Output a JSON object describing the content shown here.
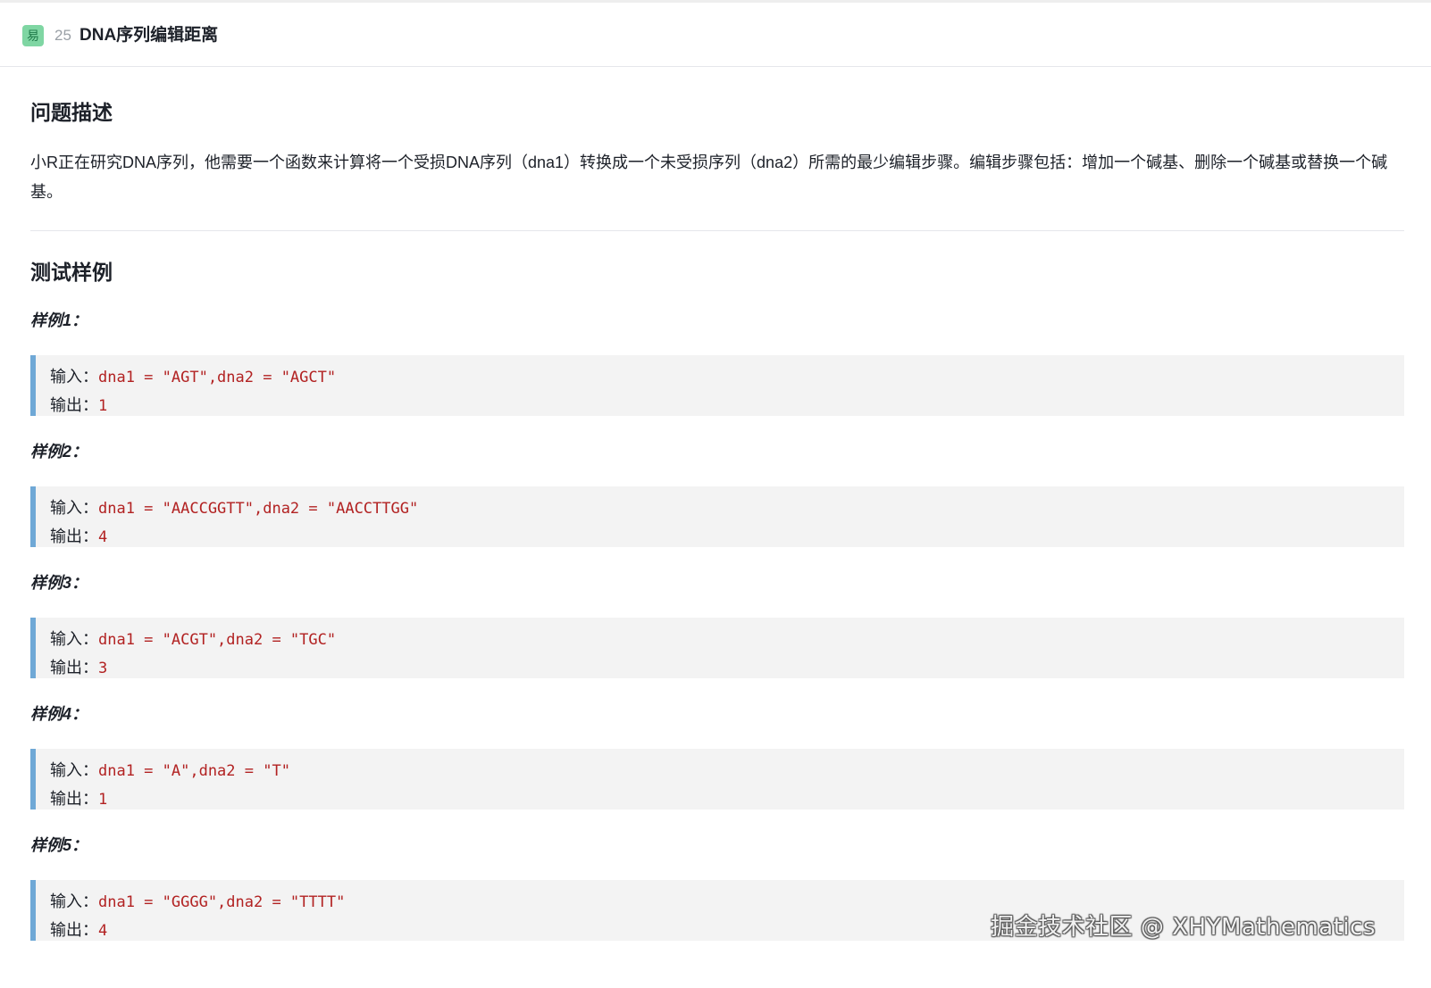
{
  "header": {
    "difficulty": "易",
    "number": "25",
    "title": "DNA序列编辑距离"
  },
  "sections": {
    "problem_heading": "问题描述",
    "problem_text": "小R正在研究DNA序列，他需要一个函数来计算将一个受损DNA序列（dna1）转换成一个未受损序列（dna2）所需的最少编辑步骤。编辑步骤包括：增加一个碱基、删除一个碱基或替换一个碱基。",
    "examples_heading": "测试样例"
  },
  "examples": [
    {
      "label": "样例1：",
      "input_prefix": "输入：",
      "input": "dna1 = \"AGT\",dna2 = \"AGCT\"",
      "output_prefix": "输出：",
      "output": "1"
    },
    {
      "label": "样例2：",
      "input_prefix": "输入：",
      "input": "dna1 = \"AACCGGTT\",dna2 = \"AACCTTGG\"",
      "output_prefix": "输出：",
      "output": "4"
    },
    {
      "label": "样例3：",
      "input_prefix": "输入：",
      "input": "dna1 = \"ACGT\",dna2 = \"TGC\"",
      "output_prefix": "输出：",
      "output": "3"
    },
    {
      "label": "样例4：",
      "input_prefix": "输入：",
      "input": "dna1 = \"A\",dna2 = \"T\"",
      "output_prefix": "输出：",
      "output": "1"
    },
    {
      "label": "样例5：",
      "input_prefix": "输入：",
      "input": "dna1 = \"GGGG\",dna2 = \"TTTT\"",
      "output_prefix": "输出：",
      "output": "4"
    }
  ],
  "watermark": "掘金技术社区 @ XHYMathematics",
  "colors": {
    "accent_border": "#6fa8d6",
    "code_value": "#b22222",
    "difficulty_badge": "#7fd6a3"
  }
}
